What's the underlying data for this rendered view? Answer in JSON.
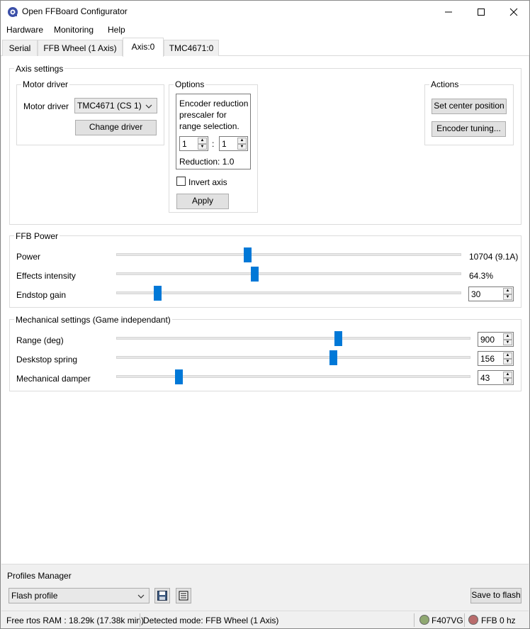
{
  "window": {
    "title": "Open FFBoard Configurator",
    "minimize": "—",
    "maximize": "☐",
    "close": "✕"
  },
  "menu": [
    "Hardware",
    "Monitoring",
    "Help"
  ],
  "tabs": [
    {
      "label": "Serial",
      "active": false
    },
    {
      "label": "FFB Wheel (1 Axis)",
      "active": false
    },
    {
      "label": "Axis:0",
      "active": true
    },
    {
      "label": "TMC4671:0",
      "active": false
    }
  ],
  "axis_settings": {
    "title": "Axis settings",
    "motor_driver_group": {
      "title": "Motor driver",
      "label": "Motor driver",
      "selected": "TMC4671 (CS 1)",
      "change_button": "Change driver"
    },
    "options_group": {
      "title": "Options",
      "encoder_desc": [
        "Encoder reduction",
        "prescaler for",
        "range selection."
      ],
      "prescaler_left": "1",
      "prescaler_sep": ":",
      "prescaler_right": "1",
      "reduction": "Reduction: 1.0",
      "invert_label": "Invert axis",
      "invert_checked": false,
      "apply_button": "Apply"
    },
    "actions_group": {
      "title": "Actions",
      "center_button": "Set center position",
      "tuning_button": "Encoder tuning..."
    }
  },
  "ffb_power": {
    "title": "FFB Power",
    "rows": [
      {
        "label": "Power",
        "value": "10704 (9.1A)",
        "level": 0.38
      },
      {
        "label": "Effects intensity",
        "value": "64.3%",
        "level": 0.4
      },
      {
        "label": "Endstop gain",
        "value": "30",
        "level": 0.12
      }
    ]
  },
  "mechanical": {
    "title": "Mechanical settings (Game independant)",
    "rows": [
      {
        "label": "Range (deg)",
        "value": "900",
        "level": 0.625
      },
      {
        "label": "Deskstop spring",
        "value": "156",
        "level": 0.612
      },
      {
        "label": "Mechanical damper",
        "value": "43",
        "level": 0.176
      }
    ]
  },
  "profiles": {
    "title": "Profiles Manager",
    "selected": "Flash profile",
    "save_to_flash": "Save to flash"
  },
  "status": {
    "ram": "Free rtos RAM : 18.29k (17.38k min)",
    "mode": "Detected mode: FFB Wheel (1 Axis)",
    "board": "F407VG",
    "ffb": "FFB 0 hz",
    "board_led_color": "#8fa871",
    "ffb_led_color": "#b86b6b",
    "accent_color": "#0078d7"
  }
}
